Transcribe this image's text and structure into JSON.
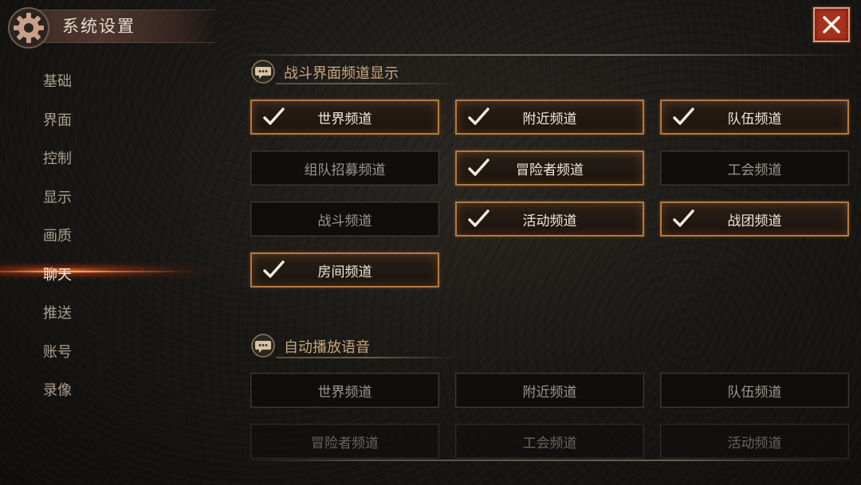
{
  "header": {
    "title": "系统设置"
  },
  "sidebar": {
    "items": [
      {
        "label": "基础"
      },
      {
        "label": "界面"
      },
      {
        "label": "控制"
      },
      {
        "label": "显示"
      },
      {
        "label": "画质"
      },
      {
        "label": "聊天",
        "active": true
      },
      {
        "label": "推送"
      },
      {
        "label": "账号"
      },
      {
        "label": "录像"
      }
    ]
  },
  "battle_display": {
    "title": "战斗界面频道显示",
    "options": [
      {
        "label": "世界频道",
        "checked": true
      },
      {
        "label": "附近频道",
        "checked": true
      },
      {
        "label": "队伍频道",
        "checked": true
      },
      {
        "label": "组队招募频道",
        "checked": false
      },
      {
        "label": "冒险者频道",
        "checked": true
      },
      {
        "label": "工会频道",
        "checked": false
      },
      {
        "label": "战斗频道",
        "checked": false
      },
      {
        "label": "活动频道",
        "checked": true
      },
      {
        "label": "战团频道",
        "checked": true
      },
      {
        "label": "房间频道",
        "checked": true
      }
    ]
  },
  "auto_voice": {
    "title": "自动播放语音",
    "options": [
      {
        "label": "世界频道",
        "checked": false
      },
      {
        "label": "附近频道",
        "checked": false
      },
      {
        "label": "队伍频道",
        "checked": false
      },
      {
        "label": "冒险者频道",
        "checked": false
      },
      {
        "label": "工会频道",
        "checked": false
      },
      {
        "label": "活动频道",
        "checked": false
      }
    ]
  },
  "colors": {
    "accent": "#b27a41",
    "close": "#a8301d",
    "section_title": "#c9a77c"
  },
  "icons": [
    "gear-icon",
    "close-icon",
    "chat-bubble-icon",
    "checkmark-icon"
  ]
}
